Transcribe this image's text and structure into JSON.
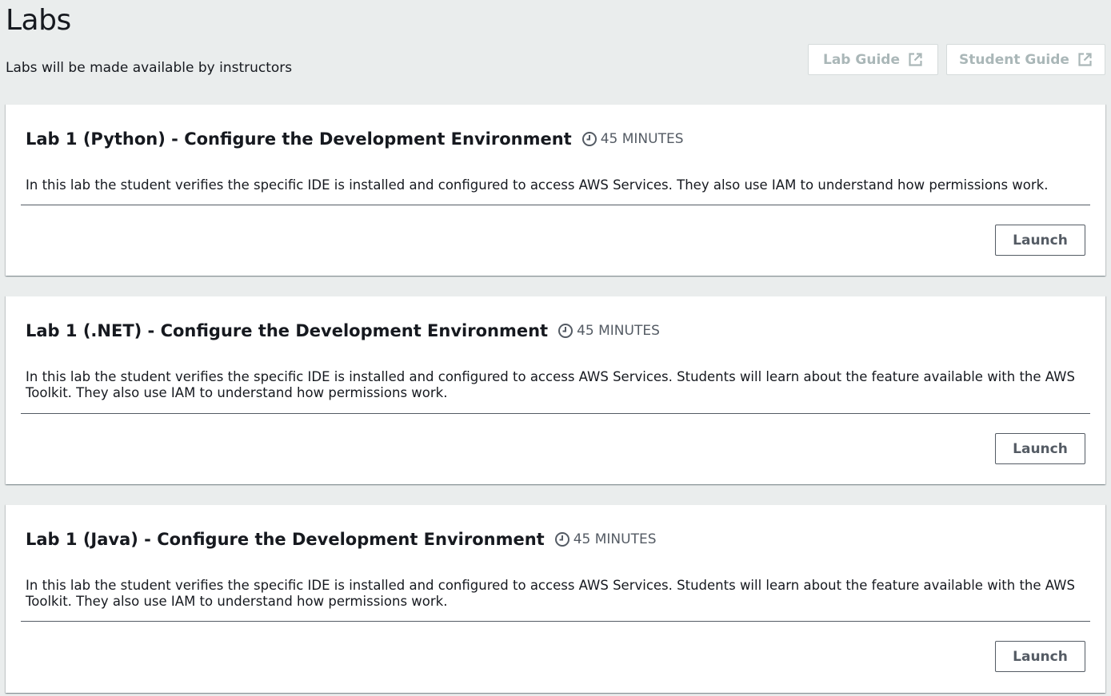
{
  "header": {
    "title": "Labs",
    "subtitle": "Labs will be made available by instructors",
    "lab_guide_label": "Lab Guide",
    "student_guide_label": "Student Guide",
    "external_icon": "external-link-icon"
  },
  "labs": [
    {
      "title": "Lab 1 (Python) - Configure the Development Environment",
      "duration": "45 MINUTES",
      "description": "In this lab the student verifies the specific IDE is installed and configured to access AWS Services. They also use IAM to understand how permissions work.",
      "launch_label": "Launch"
    },
    {
      "title": "Lab 1 (.NET) - Configure the Development Environment",
      "duration": "45 MINUTES",
      "description": "In this lab the student verifies the specific IDE is installed and configured to access AWS Services. Students will learn about the feature available with the AWS Toolkit. They also use IAM to understand how permissions work.",
      "launch_label": "Launch"
    },
    {
      "title": "Lab 1 (Java) - Configure the Development Environment",
      "duration": "45 MINUTES",
      "description": "In this lab the student verifies the specific IDE is installed and configured to access AWS Services. Students will learn about the feature available with the AWS Toolkit. They also use IAM to understand how permissions work.",
      "launch_label": "Launch"
    }
  ],
  "colors": {
    "background": "#eaeded",
    "disabled_text": "#aab7b8",
    "secondary_text": "#545b64"
  }
}
